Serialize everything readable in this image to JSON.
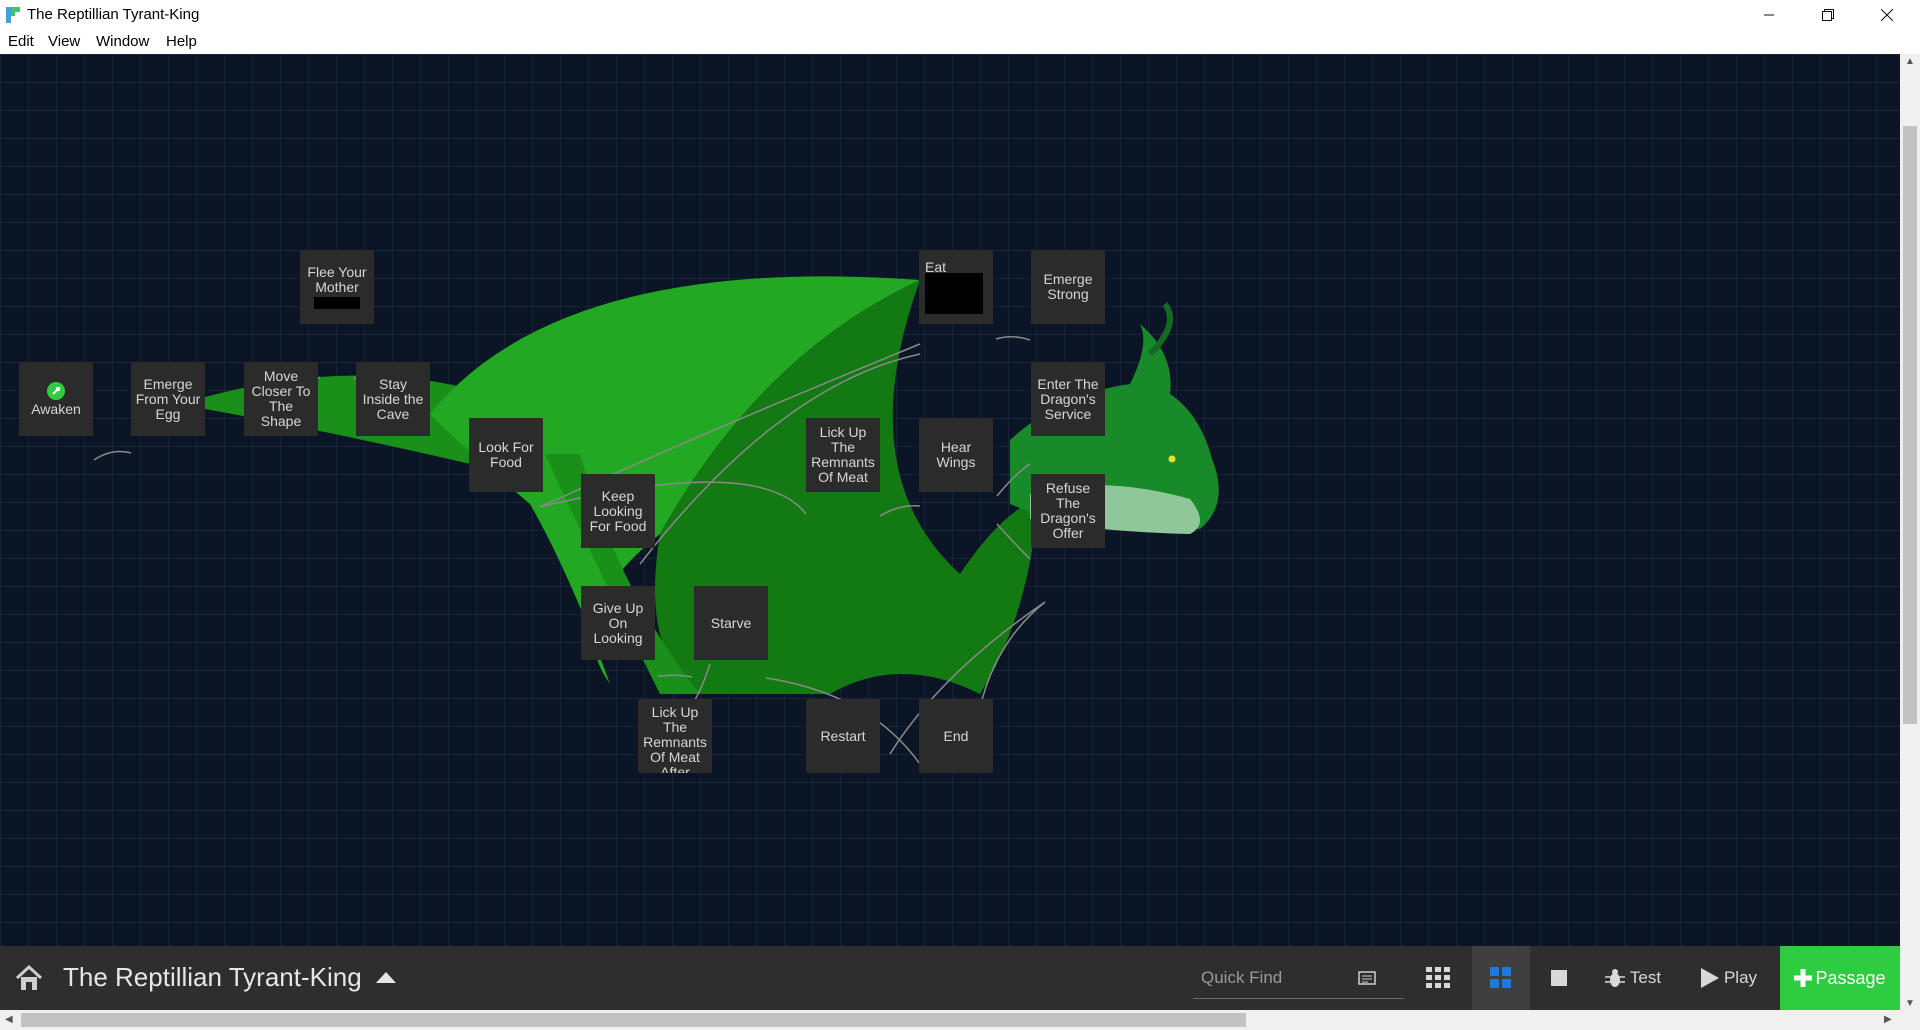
{
  "window": {
    "title": "The Reptillian Tyrant-King",
    "controls": [
      "minimize",
      "restore",
      "close"
    ]
  },
  "menu": {
    "items": [
      "Edit",
      "View",
      "Window",
      "Help"
    ]
  },
  "passages": [
    {
      "id": "awaken",
      "label": "Awaken",
      "start": true
    },
    {
      "id": "emerge-from-egg",
      "label": "Emerge From Your Egg"
    },
    {
      "id": "move-closer",
      "label": "Move Closer To The Shape"
    },
    {
      "id": "flee-mother",
      "label": "Flee Your Mother"
    },
    {
      "id": "stay-inside",
      "label": "Stay Inside the Cave"
    },
    {
      "id": "look-for-food",
      "label": "Look For Food"
    },
    {
      "id": "keep-looking",
      "label": "Keep Looking For Food"
    },
    {
      "id": "give-up",
      "label": "Give Up On Looking"
    },
    {
      "id": "starve",
      "label": "Starve"
    },
    {
      "id": "lick-up-after",
      "label": "Lick Up The Remnants Of Meat After"
    },
    {
      "id": "lick-up",
      "label": "Lick Up The Remnants Of Meat"
    },
    {
      "id": "eat",
      "label": "Eat"
    },
    {
      "id": "emerge-strong",
      "label": "Emerge Strong"
    },
    {
      "id": "hear-wings",
      "label": "Hear Wings"
    },
    {
      "id": "enter-service",
      "label": "Enter The Dragon's Service"
    },
    {
      "id": "refuse-offer",
      "label": "Refuse The Dragon's Offer"
    },
    {
      "id": "restart",
      "label": "Restart"
    },
    {
      "id": "end",
      "label": "End"
    }
  ],
  "toolbar": {
    "story_title": "The Reptillian Tyrant-King",
    "quick_find_placeholder": "Quick Find",
    "test_label": "Test",
    "play_label": "Play",
    "passage_label": "Passage",
    "active_zoom": "medium"
  },
  "colors": {
    "canvas_bg": "#0b1526",
    "passage_bg": "#2b2b2b",
    "dragon_green": "#1fa31f",
    "dragon_dark_green": "#137a13",
    "passage_button": "#2ecc40",
    "toolbar_bg": "#2e2e2e"
  }
}
